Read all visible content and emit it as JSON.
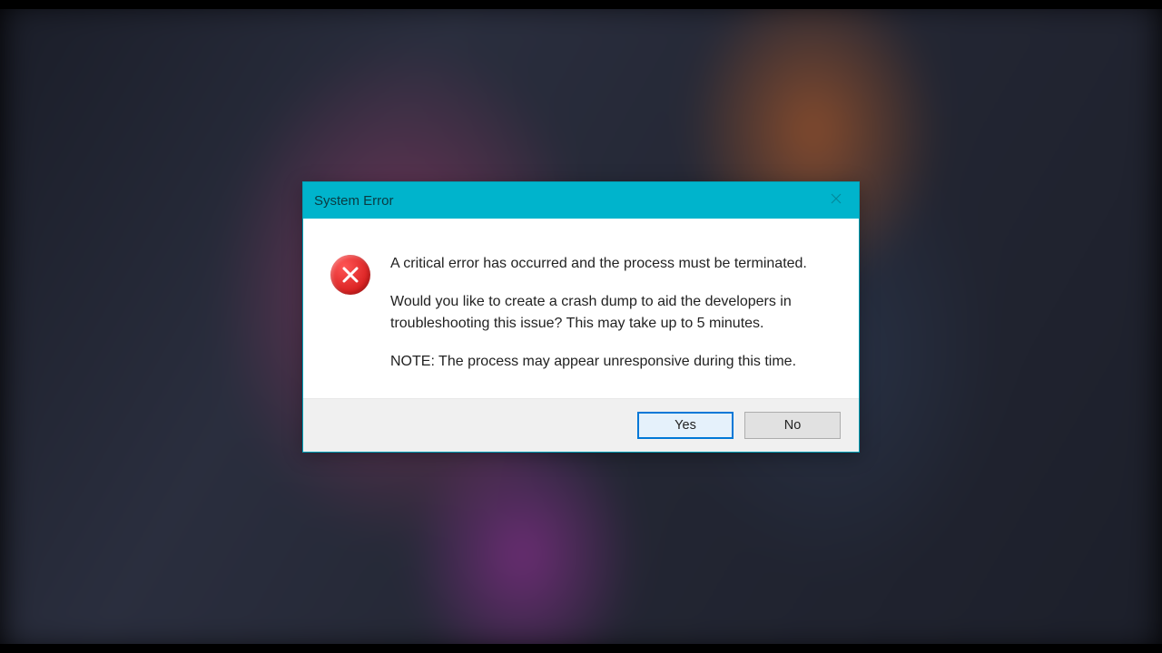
{
  "dialog": {
    "title": "System Error",
    "message_line1": "A critical error has occurred and the process must be terminated.",
    "message_line2": "Would you like to create a crash dump to aid the developers in troubleshooting this issue? This may take up to 5 minutes.",
    "message_line3": "NOTE: The process may appear unresponsive during this time.",
    "buttons": {
      "yes": "Yes",
      "no": "No"
    }
  }
}
